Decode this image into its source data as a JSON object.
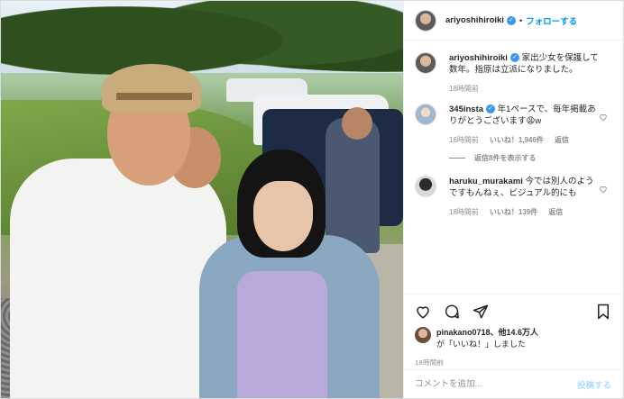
{
  "header": {
    "username": "ariyoshihiroiki",
    "separator": "•",
    "follow_label": "フォローする"
  },
  "caption": {
    "username": "ariyoshihiroiki",
    "text": "家出少女を保護して数年。指原は立派になりました。",
    "time": "18時間前"
  },
  "comments": [
    {
      "username": "345insta",
      "text": "年1ペースで、毎年掲載ありがとうございます😩w",
      "time": "16時間前",
      "likes": "いいね！1,946件",
      "reply_label": "返信",
      "view_replies": "返信8件を表示する"
    },
    {
      "username": "haruku_murakami",
      "text": "今では別人のようですもんねぇ、ビジュアル的にも",
      "time": "18時間前",
      "likes": "いいね！139件",
      "reply_label": "返信"
    }
  ],
  "likes_summary": {
    "user": "pinakano0718",
    "rest": "、他14.6万人",
    "suffix": "が「いいね！」しました"
  },
  "post_time": "18時間前",
  "composer": {
    "placeholder": "コメントを追加...",
    "post_label": "投稿する"
  },
  "colors": {
    "accent": "#0095f6",
    "verified": "#3897f0",
    "muted": "#8e8e8e",
    "post_disabled": "#b2dffc"
  },
  "icons": [
    "verified-icon",
    "heart-icon",
    "comment-icon",
    "share-icon",
    "bookmark-icon"
  ]
}
